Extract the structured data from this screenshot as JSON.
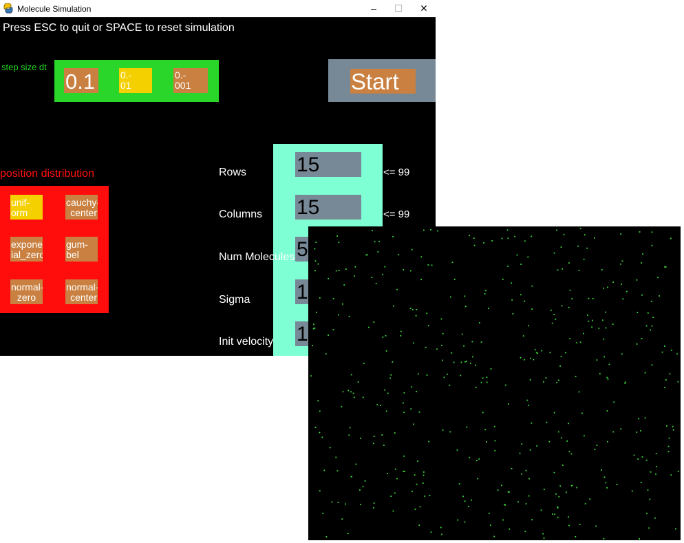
{
  "window": {
    "title": "Molecule Simulation",
    "minimize": "–",
    "maximize": "☐",
    "close": "✕"
  },
  "instructions": "Press ESC to quit or SPACE to reset simulation",
  "step": {
    "label": "step size dt",
    "options": [
      {
        "line1": "0.1",
        "line2": ""
      },
      {
        "line1": "0.-",
        "line2": "01"
      },
      {
        "line1": "0.-",
        "line2": "001"
      }
    ],
    "selected_index": 1
  },
  "start_label": "Start",
  "distribution": {
    "title": "position distribution",
    "options": [
      {
        "line1": "unif-",
        "line2": "orm"
      },
      {
        "line1": "cauchy-",
        "line2": "center"
      },
      {
        "line1": "expone",
        "line2": "ial_zero"
      },
      {
        "line1": "gum-",
        "line2": "bel"
      },
      {
        "line1": "normal-",
        "line2": "zero"
      },
      {
        "line1": "normal-",
        "line2": "center"
      }
    ],
    "selected_index": 0
  },
  "params": [
    {
      "label": "Rows",
      "value": "15",
      "limit": "<= 99"
    },
    {
      "label": "Columns",
      "value": "15",
      "limit": "<= 99"
    },
    {
      "label": "Num Molecules",
      "value": "5",
      "limit": ""
    },
    {
      "label": "Sigma",
      "value": "1",
      "limit": ""
    },
    {
      "label": "Init velocity",
      "value": "1",
      "limit": ""
    }
  ],
  "simulation": {
    "particle_color": "#3ddc3d",
    "background": "#000000",
    "particle_count": 450
  },
  "colors": {
    "step_panel": "#2bd62b",
    "button_orange": "#c98040",
    "button_selected": "#f5d000",
    "start_panel": "#778896",
    "dist_panel": "#ff0c0c",
    "param_panel": "#7fffd4"
  }
}
